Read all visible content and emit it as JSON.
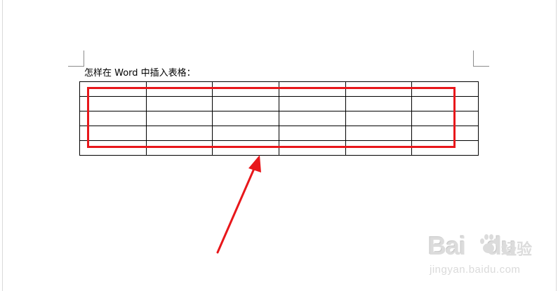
{
  "document": {
    "heading": "怎样在 Word 中插入表格：",
    "table": {
      "rows": 5,
      "columns": 6
    }
  },
  "annotation": {
    "highlight_color": "#e8171b",
    "arrow_color": "#e8171b"
  },
  "watermark": {
    "brand": "Bai",
    "brand_icon": "paw-icon",
    "brand_suffix": "du",
    "product": "经验",
    "url": "jingyan.baidu.com"
  }
}
